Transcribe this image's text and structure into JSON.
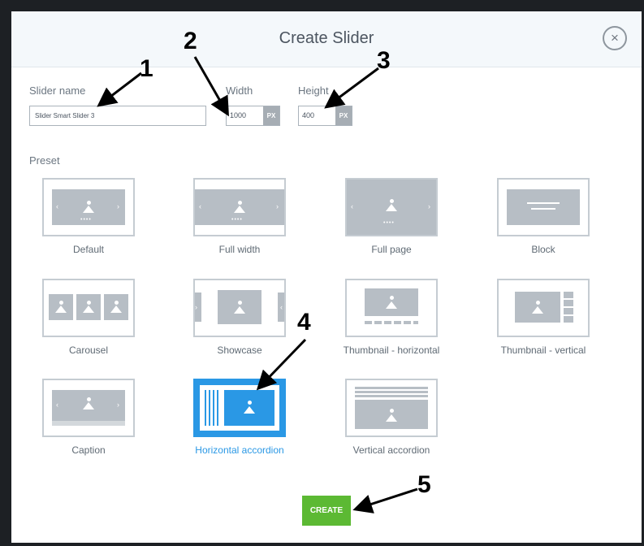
{
  "dialog": {
    "title": "Create Slider",
    "close_symbol": "×",
    "close_icon": "close-circle-icon"
  },
  "form": {
    "slider_name_label": "Slider name",
    "slider_name_value": "Slider Smart Slider 3",
    "width_label": "Width",
    "width_value": "1000",
    "width_unit": "PX",
    "height_label": "Height",
    "height_value": "400",
    "height_unit": "PX"
  },
  "preset_label": "Preset",
  "presets": [
    {
      "label": "Default",
      "icon": "default-preset-icon"
    },
    {
      "label": "Full width",
      "icon": "full-width-preset-icon"
    },
    {
      "label": "Full page",
      "icon": "full-page-preset-icon"
    },
    {
      "label": "Block",
      "icon": "block-preset-icon"
    },
    {
      "label": "Carousel",
      "icon": "carousel-preset-icon"
    },
    {
      "label": "Showcase",
      "icon": "showcase-preset-icon"
    },
    {
      "label": "Thumbnail - horizontal",
      "icon": "thumbnail-horizontal-preset-icon"
    },
    {
      "label": "Thumbnail - vertical",
      "icon": "thumbnail-vertical-preset-icon"
    },
    {
      "label": "Caption",
      "icon": "caption-preset-icon"
    },
    {
      "label": "Horizontal accordion",
      "icon": "horizontal-accordion-preset-icon",
      "selected": true
    },
    {
      "label": "Vertical accordion",
      "icon": "vertical-accordion-preset-icon"
    }
  ],
  "create_label": "CREATE",
  "callouts": [
    "1",
    "2",
    "3",
    "4",
    "5"
  ],
  "colors": {
    "accent": "#2a98e5",
    "create_button": "#5cb933",
    "placeholder_gray": "#b7bec5"
  }
}
